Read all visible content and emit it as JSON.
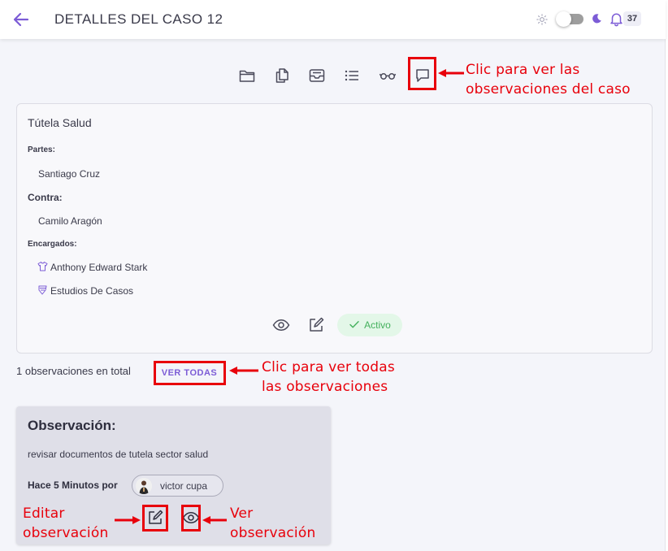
{
  "header": {
    "title": "DETALLES DEL CASO 12",
    "notification_count": "37"
  },
  "toolbar": {
    "icons": [
      "folder-icon",
      "documents-icon",
      "inbox-icon",
      "list-icon",
      "glasses-icon",
      "comment-icon"
    ]
  },
  "case": {
    "title": "Tútela Salud",
    "parties_label": "Partes:",
    "party": "Santiago Cruz",
    "against_label": "Contra:",
    "opponent": "Camilo Aragón",
    "managers_label": "Encargados:",
    "managers": [
      "Anthony Edward Stark",
      "Estudios De Casos"
    ],
    "status": "Activo"
  },
  "observations": {
    "total_text": "1 observaciones en total",
    "view_all_label": "VER TODAS",
    "card": {
      "title": "Observación:",
      "text": "revisar documentos de tutela sector salud",
      "meta": "Hace 5 Minutos por",
      "user": "victor cupa"
    }
  },
  "annotations": {
    "comments": [
      "Clic para ver las",
      "observaciones del caso"
    ],
    "view_all": [
      "Clic para ver todas",
      "las observaciones"
    ],
    "edit": [
      "Editar",
      "observación"
    ],
    "view": [
      "Ver",
      "observación"
    ]
  },
  "colors": {
    "accent": "#7c5cd6",
    "annotation": "#e8000b",
    "status_bg": "#e3f7e8",
    "status_text": "#43b05c"
  }
}
